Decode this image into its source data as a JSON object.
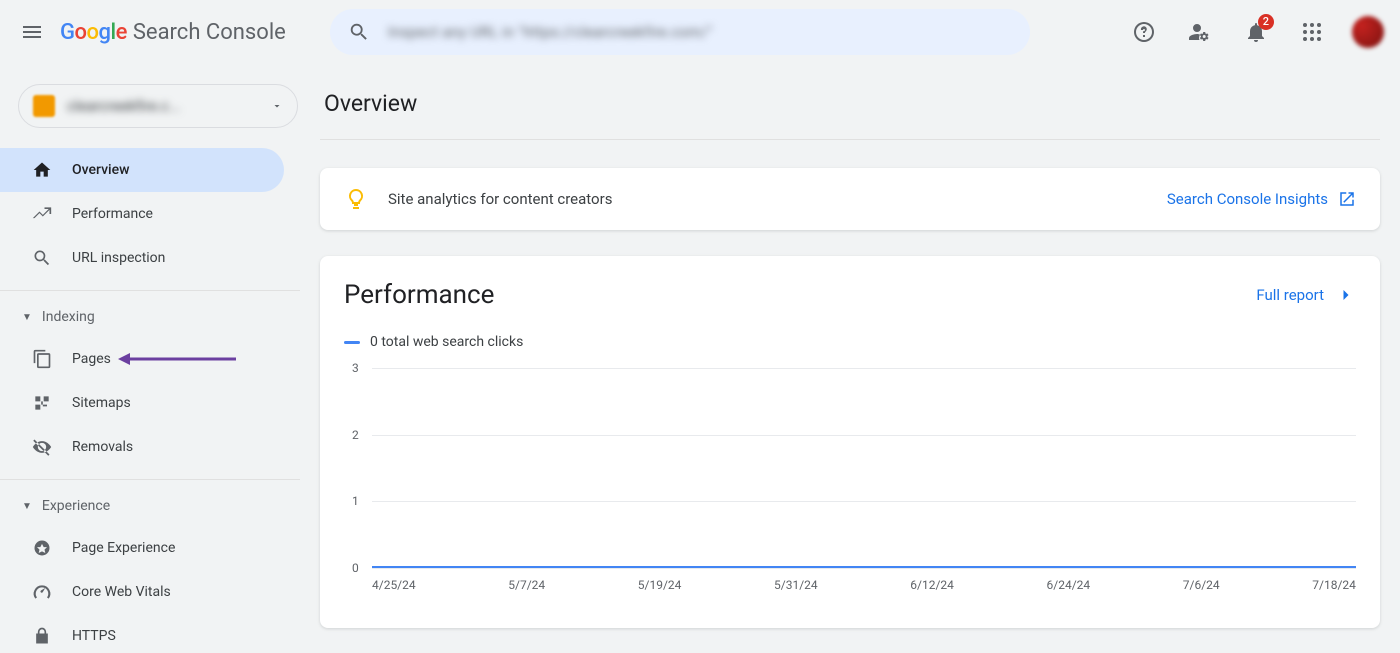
{
  "brand": {
    "google": "Google",
    "product": "Search Console"
  },
  "topbar": {
    "search_placeholder": "Inspect any URL in \"https://clearcreekfire.com/\"",
    "notification_count": "2"
  },
  "sidebar": {
    "property": {
      "label": "clearcreekfire.c..."
    },
    "primary": [
      {
        "icon": "home",
        "label": "Overview",
        "active": true
      },
      {
        "icon": "trend",
        "label": "Performance",
        "active": false
      },
      {
        "icon": "search",
        "label": "URL inspection",
        "active": false
      }
    ],
    "sections": [
      {
        "title": "Indexing",
        "items": [
          {
            "icon": "pages",
            "label": "Pages",
            "annotated": true
          },
          {
            "icon": "sitemaps",
            "label": "Sitemaps"
          },
          {
            "icon": "removals",
            "label": "Removals"
          }
        ]
      },
      {
        "title": "Experience",
        "items": [
          {
            "icon": "pageexp",
            "label": "Page Experience"
          },
          {
            "icon": "cwv",
            "label": "Core Web Vitals"
          },
          {
            "icon": "https",
            "label": "HTTPS"
          }
        ]
      }
    ]
  },
  "main": {
    "title": "Overview",
    "insights": {
      "text": "Site analytics for content creators",
      "link": "Search Console Insights"
    },
    "performance": {
      "title": "Performance",
      "link": "Full report",
      "legend": "0 total web search clicks"
    }
  },
  "chart_data": {
    "type": "line",
    "title": "",
    "xlabel": "",
    "ylabel": "",
    "ylim": [
      0,
      3
    ],
    "y_ticks": [
      3,
      2,
      1,
      0
    ],
    "categories": [
      "4/25/24",
      "5/7/24",
      "5/19/24",
      "5/31/24",
      "6/12/24",
      "6/24/24",
      "7/6/24",
      "7/18/24"
    ],
    "series": [
      {
        "name": "total web search clicks",
        "color": "#4285f4",
        "values": [
          0,
          0,
          0,
          0,
          0,
          0,
          0,
          0
        ]
      }
    ]
  }
}
